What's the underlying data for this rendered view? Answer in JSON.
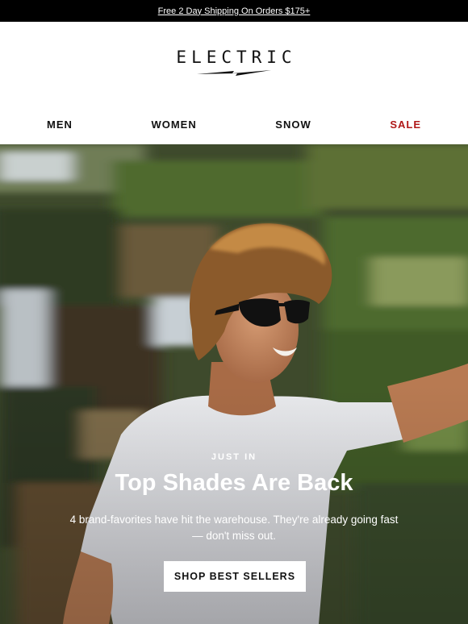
{
  "promo_bar": {
    "text": "Free 2 Day Shipping On Orders $175+"
  },
  "brand": {
    "logo_text": "ELECTRIC",
    "bolt_icon": "lightning-bolt-icon"
  },
  "nav": {
    "items": [
      {
        "label": "MEN"
      },
      {
        "label": "WOMEN"
      },
      {
        "label": "SNOW"
      },
      {
        "label": "SALE",
        "color": "#b01818"
      }
    ]
  },
  "hero": {
    "eyebrow": "JUST IN",
    "title": "Top Shades Are Back",
    "body": "4 brand-favorites have hit the warehouse. They're already going fast — don't miss out.",
    "cta_label": "SHOP BEST SELLERS"
  },
  "colors": {
    "promo_bg": "#000000",
    "sale": "#b01818",
    "cta_bg": "#ffffff",
    "hero_foliage": "#3d4a2a"
  }
}
